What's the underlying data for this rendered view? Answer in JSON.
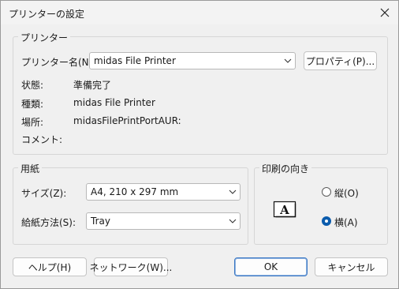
{
  "window": {
    "title": "プリンターの設定"
  },
  "printer_group": {
    "legend": "プリンター",
    "name_label": "プリンター名(N):",
    "name_value": "midas File Printer",
    "properties_button": "プロパティ(P)...",
    "status_label": "状態:",
    "status_value": "準備完了",
    "type_label": "種類:",
    "type_value": "midas File Printer",
    "location_label": "場所:",
    "location_value": "midasFilePrintPortAUR:",
    "comment_label": "コメント:",
    "comment_value": ""
  },
  "paper_group": {
    "legend": "用紙",
    "size_label": "サイズ(Z):",
    "size_value": "A4, 210 x 297 mm",
    "source_label": "給紙方法(S):",
    "source_value": "Tray"
  },
  "orientation_group": {
    "legend": "印刷の向き",
    "portrait_label": "縦(O)",
    "landscape_label": "横(A)",
    "selected": "landscape",
    "icon_letter": "A"
  },
  "footer": {
    "help_button": "ヘルプ(H)",
    "network_button": "ネットワーク(W)...",
    "ok_button": "OK",
    "cancel_button": "キャンセル"
  },
  "colors": {
    "accent": "#0b5cad",
    "ok_border": "#3b78c4"
  }
}
